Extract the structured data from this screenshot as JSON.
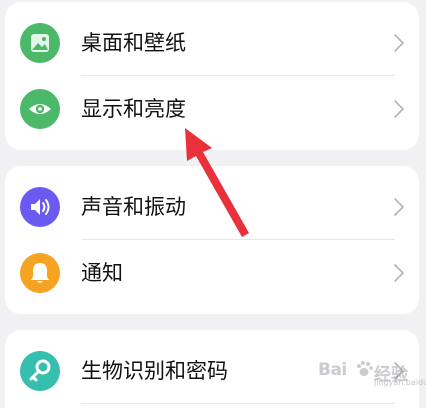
{
  "groups": [
    {
      "items": [
        {
          "label": "桌面和壁纸",
          "icon": "wallpaper-icon",
          "color": "#4cb86a"
        },
        {
          "label": "显示和亮度",
          "icon": "eye-icon",
          "color": "#4cb86a"
        }
      ]
    },
    {
      "items": [
        {
          "label": "声音和振动",
          "icon": "speaker-icon",
          "color": "#6a5af0"
        },
        {
          "label": "通知",
          "icon": "bell-icon",
          "color": "#f5a320"
        }
      ]
    },
    {
      "items": [
        {
          "label": "生物识别和密码",
          "icon": "key-icon",
          "color": "#36bfae"
        }
      ]
    }
  ],
  "annotation_color": "#e8313a",
  "watermark": {
    "brand": "Bai",
    "suffix": "经验",
    "sub": "jingyan.baidu.com"
  }
}
